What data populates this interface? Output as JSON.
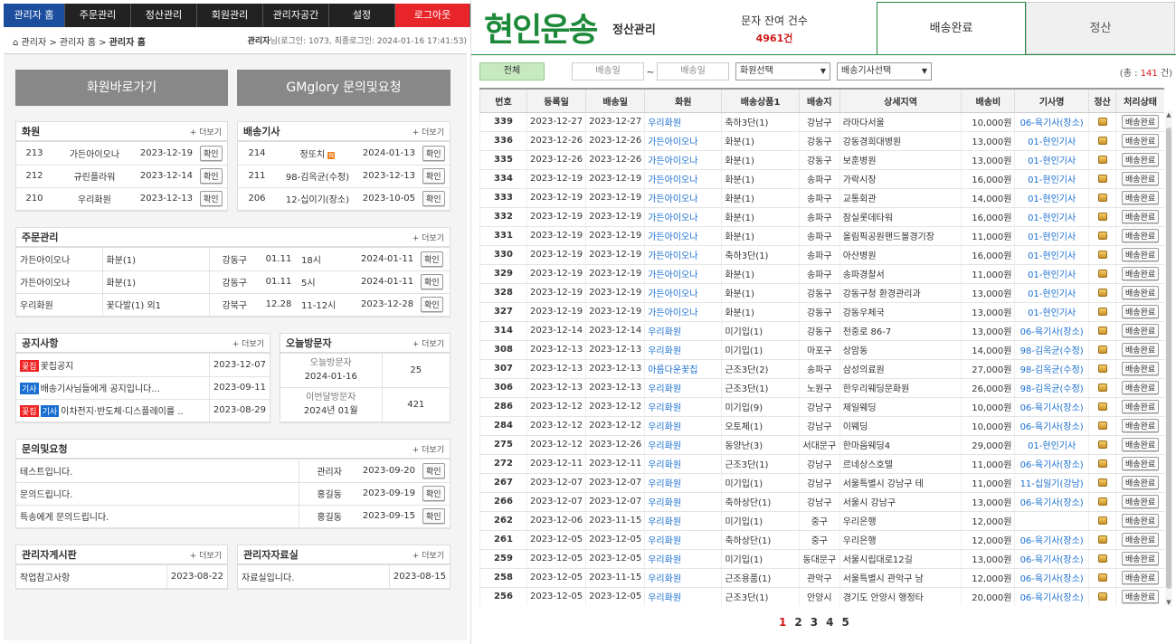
{
  "nav": {
    "items": [
      "관리자 홈",
      "주문관리",
      "정산관리",
      "회원관리",
      "관리자공간",
      "설정",
      "로그아웃"
    ]
  },
  "breadcrumb": {
    "path1": "관리자",
    "sep": ">",
    "path2": "관리자 홈",
    "current": "관리자 홈",
    "user_label": "관리자",
    "user_meta": "님(로그인: 1073, 최종로그인: 2024-01-16 17:41:53)"
  },
  "shortcuts": {
    "member": "화원바로가기",
    "inquiry": "GMglory 문의및요청"
  },
  "more_label": "+ 더보기",
  "ok_label": "확인",
  "members_box": {
    "title": "화원",
    "rows": [
      {
        "no": "213",
        "name": "가든아이오나",
        "date": "2023-12-19"
      },
      {
        "no": "212",
        "name": "규린플라워",
        "date": "2023-12-14"
      },
      {
        "no": "210",
        "name": "우리화원",
        "date": "2023-12-13"
      }
    ]
  },
  "drivers_box": {
    "title": "배송기사",
    "new_mark": "N",
    "rows": [
      {
        "no": "214",
        "name": "정또치",
        "date": "2024-01-13"
      },
      {
        "no": "211",
        "name": "98-김옥균(수정)",
        "date": "2023-12-13"
      },
      {
        "no": "206",
        "name": "12-십이기(장소)",
        "date": "2023-10-05"
      }
    ]
  },
  "orders_box": {
    "title": "주문관리",
    "rows": [
      {
        "shop": "가든아이오나",
        "item": "화분(1)",
        "area": "강동구",
        "d": "01.11",
        "time": "18시",
        "date": "2024-01-11"
      },
      {
        "shop": "가든아이오나",
        "item": "화분(1)",
        "area": "강동구",
        "d": "01.11",
        "time": "5시",
        "date": "2024-01-11"
      },
      {
        "shop": "우리화원",
        "item": "꽃다발(1) 외1",
        "area": "강북구",
        "d": "12.28",
        "time": "11-12시",
        "date": "2023-12-28"
      }
    ]
  },
  "notice_box": {
    "title": "공지사항",
    "tag_shop": "꽃집",
    "tag_driver": "기사",
    "rows": [
      {
        "text": "꽃집공지",
        "date": "2023-12-07"
      },
      {
        "text": "배송기사님들에게 공지입니다...",
        "date": "2023-09-11"
      },
      {
        "text": "이차전지·반도체·디스플레이를 ..",
        "date": "2023-08-29"
      }
    ]
  },
  "visitors_box": {
    "title": "오늘방문자",
    "today_label": "오늘방문자",
    "today_date": "2024-01-16",
    "today_count": "25",
    "month_label": "이번달방문자",
    "month_date": "2024년 01월",
    "month_count": "421"
  },
  "qna_box": {
    "title": "문의및요청",
    "rows": [
      {
        "text": "테스트입니다.",
        "writer": "관리자",
        "date": "2023-09-20"
      },
      {
        "text": "문의드립니다.",
        "writer": "홍길동",
        "date": "2023-09-19"
      },
      {
        "text": "특송에게 문의드립니다.",
        "writer": "홍길동",
        "date": "2023-09-15"
      }
    ]
  },
  "board_box": {
    "title": "관리자게시판",
    "rows": [
      {
        "text": "작업참고사항",
        "date": "2023-08-22"
      }
    ]
  },
  "data_box": {
    "title": "관리자자료실",
    "rows": [
      {
        "text": "자료실입니다.",
        "date": "2023-08-15"
      }
    ]
  },
  "brand": {
    "logo": "현인운송",
    "sub": "정산관리"
  },
  "sms": {
    "label": "문자 잔여 건수",
    "value": "4961건"
  },
  "tabs": [
    "배송완료",
    "정산"
  ],
  "filter": {
    "all": "전체",
    "date_from": "배송일",
    "tilde": "~",
    "date_to": "배송일",
    "member_select": "화원선택",
    "driver_select": "배송기사선택",
    "total_prefix": "(총 : ",
    "total_count": "141",
    "total_suffix": " 건)"
  },
  "grid": {
    "columns": [
      "번호",
      "등록일",
      "배송일",
      "화원",
      "배송상품1",
      "배송지",
      "상세지역",
      "배송비",
      "기사명",
      "정산",
      "처리상태"
    ],
    "status_label": "배송완료",
    "rows": [
      [
        "339",
        "2023-12-27",
        "2023-12-27",
        "우리화원",
        "축하3단(1)",
        "강남구",
        "라마다서울",
        "10,000원",
        "06-육기사(장소)"
      ],
      [
        "336",
        "2023-12-26",
        "2023-12-26",
        "가든아이오나",
        "화분(1)",
        "강동구",
        "강동경희대병원",
        "13,000원",
        "01-현인기사"
      ],
      [
        "335",
        "2023-12-26",
        "2023-12-26",
        "가든아이오나",
        "화분(1)",
        "강동구",
        "보훈병원",
        "13,000원",
        "01-현인기사"
      ],
      [
        "334",
        "2023-12-19",
        "2023-12-19",
        "가든아이오나",
        "화분(1)",
        "송파구",
        "가락시장",
        "16,000원",
        "01-현인기사"
      ],
      [
        "333",
        "2023-12-19",
        "2023-12-19",
        "가든아이오나",
        "화분(1)",
        "송파구",
        "교통회관",
        "14,000원",
        "01-현인기사"
      ],
      [
        "332",
        "2023-12-19",
        "2023-12-19",
        "가든아이오나",
        "화분(1)",
        "송파구",
        "잠실롯데타워",
        "16,000원",
        "01-현인기사"
      ],
      [
        "331",
        "2023-12-19",
        "2023-12-19",
        "가든아이오나",
        "화분(1)",
        "송파구",
        "올림픽공원핸드볼경기장",
        "11,000원",
        "01-현인기사"
      ],
      [
        "330",
        "2023-12-19",
        "2023-12-19",
        "가든아이오나",
        "축하3단(1)",
        "송파구",
        "아산병원",
        "16,000원",
        "01-현인기사"
      ],
      [
        "329",
        "2023-12-19",
        "2023-12-19",
        "가든아이오나",
        "화분(1)",
        "송파구",
        "송파경찰서",
        "11,000원",
        "01-현인기사"
      ],
      [
        "328",
        "2023-12-19",
        "2023-12-19",
        "가든아이오나",
        "화분(1)",
        "강동구",
        "강동구청 환경관리과",
        "13,000원",
        "01-현인기사"
      ],
      [
        "327",
        "2023-12-19",
        "2023-12-19",
        "가든아이오나",
        "화분(1)",
        "강동구",
        "강동우체국",
        "13,000원",
        "01-현인기사"
      ],
      [
        "314",
        "2023-12-14",
        "2023-12-14",
        "우리화원",
        "미기입(1)",
        "강동구",
        "천중로 86-7",
        "13,000원",
        "06-육기사(장소)"
      ],
      [
        "308",
        "2023-12-13",
        "2023-12-13",
        "우리화원",
        "미기입(1)",
        "마포구",
        "상암동",
        "14,000원",
        "98-김옥균(수정)"
      ],
      [
        "307",
        "2023-12-13",
        "2023-12-13",
        "아름다운꽃집",
        "근조3단(2)",
        "송파구",
        "삼성의료원",
        "27,000원",
        "98-김옥균(수정)"
      ],
      [
        "306",
        "2023-12-13",
        "2023-12-13",
        "우리화원",
        "근조3단(1)",
        "노원구",
        "한우리웨딩문화원",
        "26,000원",
        "98-김옥균(수정)"
      ],
      [
        "286",
        "2023-12-12",
        "2023-12-12",
        "우리화원",
        "미기입(9)",
        "강남구",
        "제일웨딩",
        "10,000원",
        "06-육기사(장소)"
      ],
      [
        "284",
        "2023-12-12",
        "2023-12-12",
        "우리화원",
        "오토체(1)",
        "강남구",
        "이웨딩",
        "10,000원",
        "06-육기사(장소)"
      ],
      [
        "275",
        "2023-12-12",
        "2023-12-26",
        "우리화원",
        "동양난(3)",
        "서대문구",
        "한마음웨딩4",
        "29,000원",
        "01-현인기사"
      ],
      [
        "272",
        "2023-12-11",
        "2023-12-11",
        "우리화원",
        "근조3단(1)",
        "강남구",
        "르네상스호텔",
        "11,000원",
        "06-육기사(장소)"
      ],
      [
        "267",
        "2023-12-07",
        "2023-12-07",
        "우리화원",
        "미기입(1)",
        "강남구",
        "서울특별시 강남구 테",
        "11,000원",
        "11-십일기(강남)"
      ],
      [
        "266",
        "2023-12-07",
        "2023-12-07",
        "우리화원",
        "축하상단(1)",
        "강남구",
        "서울시 강남구",
        "13,000원",
        "06-육기사(장소)"
      ],
      [
        "262",
        "2023-12-06",
        "2023-11-15",
        "우리화원",
        "미기입(1)",
        "중구",
        "우리은행",
        "12,000원",
        ""
      ],
      [
        "261",
        "2023-12-05",
        "2023-12-05",
        "우리화원",
        "축하상단(1)",
        "중구",
        "우리은행",
        "12,000원",
        "06-육기사(장소)"
      ],
      [
        "259",
        "2023-12-05",
        "2023-12-05",
        "우리화원",
        "미기입(1)",
        "동대문구",
        "서울시립대로12길",
        "13,000원",
        "06-육기사(장소)"
      ],
      [
        "258",
        "2023-12-05",
        "2023-11-15",
        "우리화원",
        "근조용품(1)",
        "관악구",
        "서울특별시 관악구 남",
        "12,000원",
        "06-육기사(장소)"
      ],
      [
        "256",
        "2023-12-05",
        "2023-12-05",
        "우리화원",
        "근조3단(1)",
        "안양시",
        "경기도 안양시 행정타",
        "20,000원",
        "06-육기사(장소)"
      ]
    ]
  },
  "pager": [
    "1",
    "2",
    "3",
    "4",
    "5"
  ],
  "colors": {
    "brand_green": "#1d8a3a",
    "nav_active": "#1d4e9e",
    "logout_red": "#e8252a",
    "link_blue": "#1a6fd0",
    "count_red": "#d01818"
  }
}
